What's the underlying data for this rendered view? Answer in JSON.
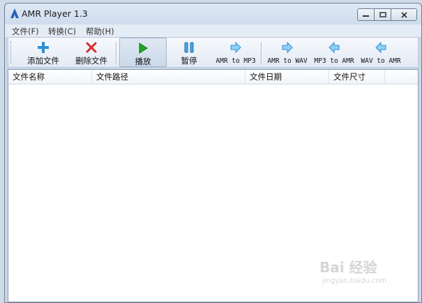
{
  "window": {
    "title": "AMR Player 1.3"
  },
  "menu": [
    "文件(F)",
    "转换(C)",
    "帮助(H)"
  ],
  "toolbar": {
    "add": "添加文件",
    "delete": "删除文件",
    "play": "播放",
    "pause": "暂停",
    "amr_to_mp3": "AMR to MP3",
    "amr_to_wav": "AMR to WAV",
    "mp3_to_amr": "MP3 to AMR",
    "wav_to_amr": "WAV to AMR"
  },
  "columns": [
    "文件名称",
    "文件路径",
    "文件日期",
    "文件尺寸"
  ],
  "watermark": {
    "brand": "Bai 经验",
    "url": "jingyan.baidu.com"
  },
  "colors": {
    "accent": "#2a8fd6",
    "play_green": "#1ea81e",
    "delete_red": "#d62c2c"
  },
  "icons": {
    "add": "plus-icon",
    "delete": "x-icon",
    "play": "play-icon",
    "pause": "pause-icon",
    "convert": "arrow-icon"
  }
}
